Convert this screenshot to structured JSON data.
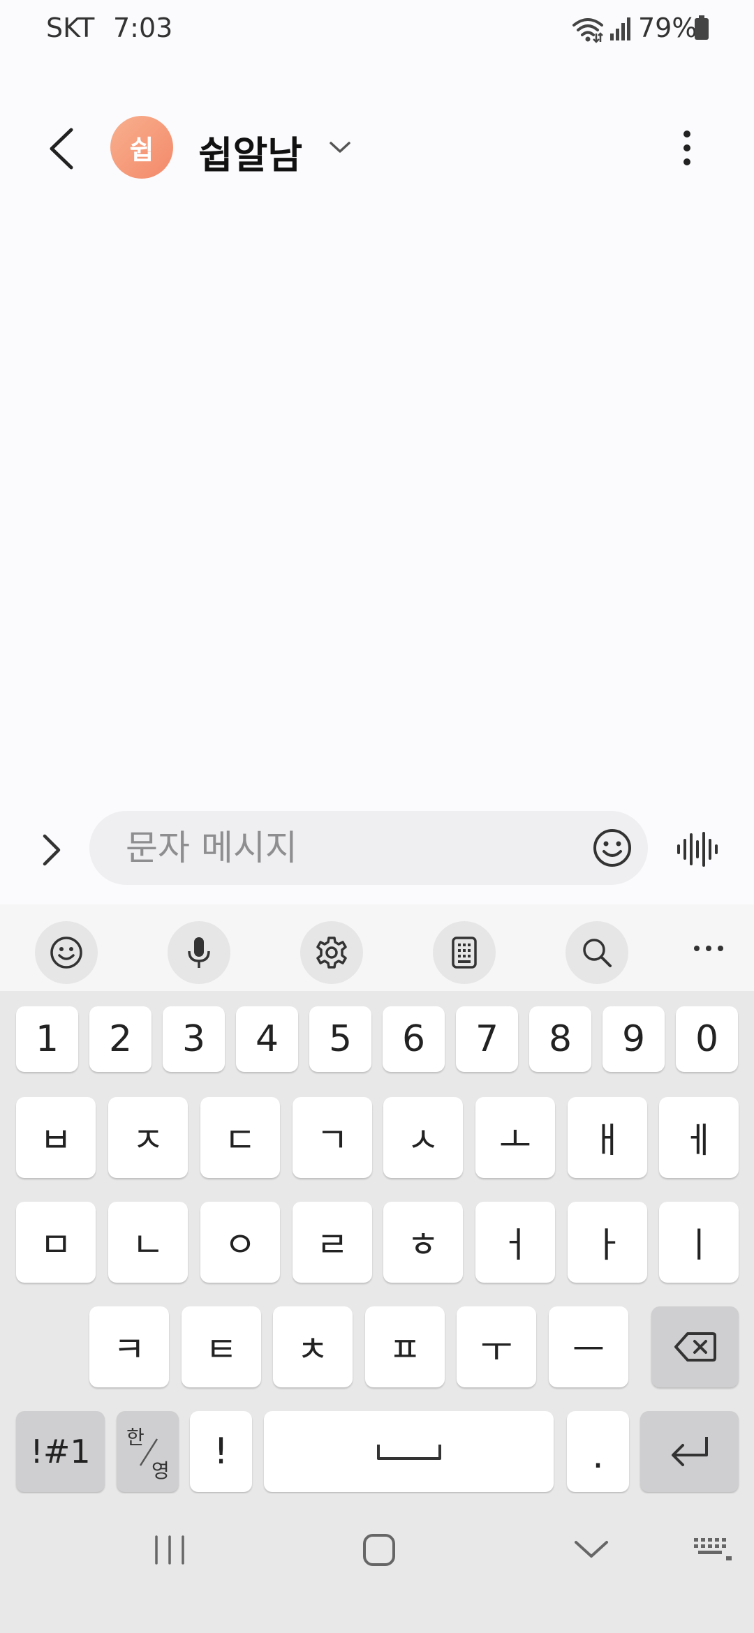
{
  "status_bar": {
    "carrier": "SKT",
    "time": "7:03",
    "battery": "79%"
  },
  "header": {
    "avatar_initial": "쉽",
    "contact_name": "쉽알남"
  },
  "compose": {
    "placeholder": "문자 메시지",
    "value": ""
  },
  "keyboard": {
    "number_row": [
      "1",
      "2",
      "3",
      "4",
      "5",
      "6",
      "7",
      "8",
      "9",
      "0"
    ],
    "row1": [
      "ㅂ",
      "ㅈ",
      "ㄷ",
      "ㄱ",
      "ㅅ",
      "ㅗ",
      "ㅐ",
      "ㅔ"
    ],
    "row2": [
      "ㅁ",
      "ㄴ",
      "ㅇ",
      "ㄹ",
      "ㅎ",
      "ㅓ",
      "ㅏ",
      "ㅣ"
    ],
    "row3": [
      "ㅋ",
      "ㅌ",
      "ㅊ",
      "ㅍ",
      "ㅜ",
      "ㅡ"
    ],
    "symbols_label": "!#1",
    "lang_top": "한",
    "lang_bottom": "영",
    "exclaim": "!",
    "period": "."
  },
  "colors": {
    "avatar_start": "#f8b08e",
    "avatar_end": "#f3896a",
    "keyboard_bg": "#e8e8e8",
    "function_key": "#cfcfd1"
  }
}
